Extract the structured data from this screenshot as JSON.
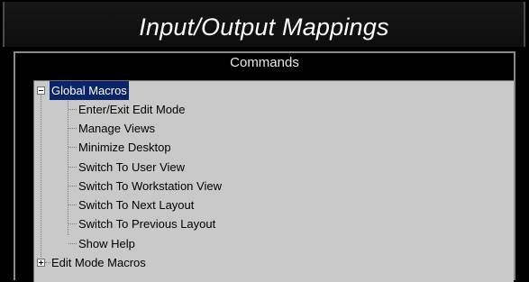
{
  "window": {
    "title": "Input/Output Mappings"
  },
  "commands": {
    "group_label": "Commands",
    "tree": {
      "root": {
        "label": "Global Macros",
        "expanded": true,
        "selected": true
      },
      "children": [
        {
          "label": "Enter/Exit Edit Mode"
        },
        {
          "label": "Manage Views"
        },
        {
          "label": "Minimize Desktop"
        },
        {
          "label": "Switch To User View"
        },
        {
          "label": "Switch To Workstation View"
        },
        {
          "label": "Switch To Next Layout"
        },
        {
          "label": "Switch To Previous Layout"
        },
        {
          "label": "Show Help"
        }
      ],
      "second_root": {
        "label": "Edit Mode Macros",
        "expanded": false
      }
    }
  },
  "colors": {
    "selection": "#0a246a",
    "tree_background": "#c9c9c9",
    "background": "#000000"
  },
  "icons": [
    "collapse-minus-icon",
    "expand-plus-icon"
  ]
}
